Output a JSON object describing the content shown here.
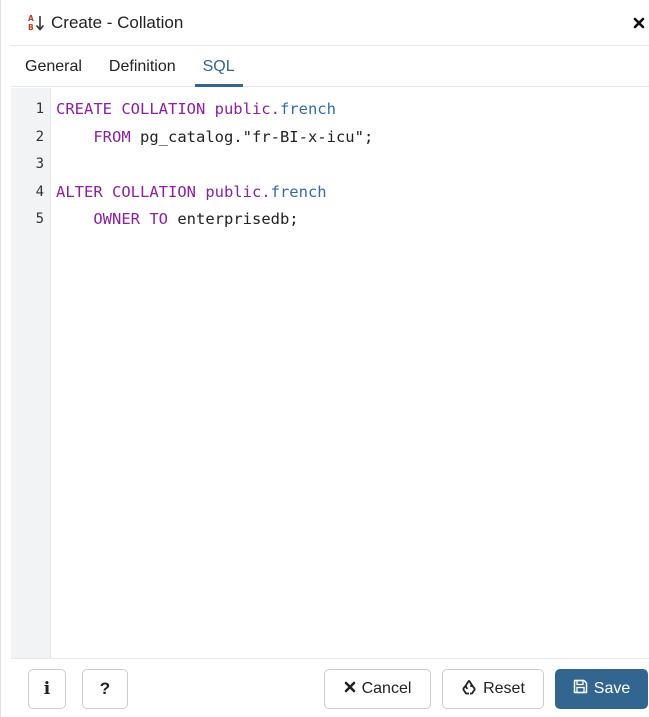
{
  "dialog": {
    "title": "Create - Collation",
    "title_icon": "collation-sort-icon",
    "close_icon": "close-icon"
  },
  "tabs": [
    {
      "label": "General",
      "active": false
    },
    {
      "label": "Definition",
      "active": false
    },
    {
      "label": "SQL",
      "active": true
    }
  ],
  "editor": {
    "line_numbers": [
      "1",
      "2",
      "3",
      "4",
      "5"
    ],
    "lines": [
      [
        {
          "t": "CREATE COLLATION ",
          "c": "kw"
        },
        {
          "t": "public.",
          "c": "kw"
        },
        {
          "t": "french",
          "c": "nm"
        }
      ],
      [
        {
          "t": "    FROM ",
          "c": "kw"
        },
        {
          "t": "pg_catalog.\"fr-BI-x-icu\";",
          "c": "tx"
        }
      ],
      [],
      [
        {
          "t": "ALTER COLLATION ",
          "c": "kw"
        },
        {
          "t": "public.",
          "c": "kw"
        },
        {
          "t": "french",
          "c": "nm"
        }
      ],
      [
        {
          "t": "    OWNER TO ",
          "c": "kw"
        },
        {
          "t": "enterprisedb;",
          "c": "tx"
        }
      ]
    ]
  },
  "footer": {
    "info_label": "i",
    "help_label": "?",
    "cancel_label": "Cancel",
    "reset_label": "Reset",
    "save_label": "Save",
    "accent_color": "#326690"
  }
}
